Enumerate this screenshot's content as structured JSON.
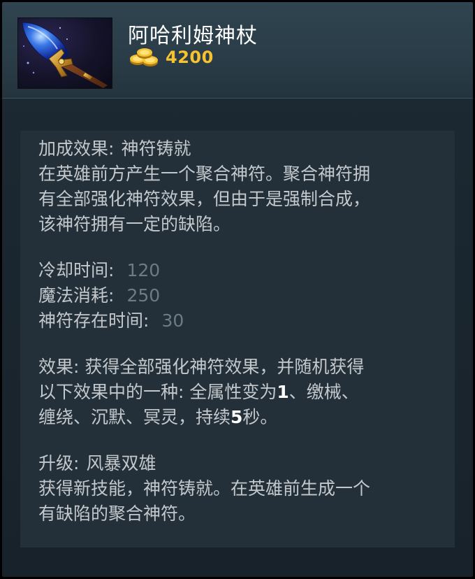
{
  "item": {
    "name": "阿哈利姆神杖",
    "cost": "4200",
    "icon": "aghanims-scepter-icon",
    "cost_icon": "gold-coins-icon"
  },
  "colors": {
    "gold": "#f6c330",
    "text": "#c3c8cc",
    "dim_value": "#6c7b86",
    "highlight": "#ffffff",
    "panel": "#233039",
    "header": "#2f4450"
  },
  "bonus": {
    "label": "加成效果:",
    "ability": "神符铸就",
    "desc_lines": [
      "在英雄前方产生一个聚合神符。聚合神符拥",
      "有全部强化神符效果，但由于是强制合成，",
      "该神符拥有一定的缺陷。"
    ]
  },
  "stats": [
    {
      "label": "冷却时间:",
      "value": "120"
    },
    {
      "label": "魔法消耗:",
      "value": "250"
    },
    {
      "label": "神符存在时间:",
      "value": "30"
    }
  ],
  "effect": {
    "line1": "效果: 获得全部强化神符效果，并随机获得",
    "line2_a": "以下效果中的一种: 全属性变为",
    "line2_num": "1",
    "line2_b": "、缴械、",
    "line3_a": "缠绕、沉默、冥灵，持续",
    "line3_num": "5",
    "line3_b": "秒。"
  },
  "upgrade": {
    "label": "升级:",
    "name": "风暴双雄",
    "desc_lines": [
      "获得新技能，神符铸就。在英雄前生成一个",
      "有缺陷的聚合神符。"
    ]
  }
}
